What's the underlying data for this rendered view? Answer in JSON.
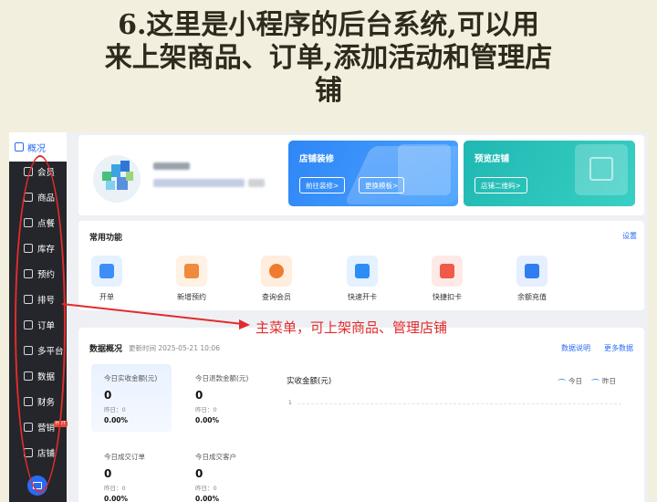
{
  "caption": {
    "line1": "6.这里是小程序的后台系统,可以用",
    "line2": "来上架商品、订单,添加活动和管理店",
    "line3": "铺"
  },
  "sidebar": {
    "active": {
      "label": "概况",
      "icon": "grid-icon"
    },
    "items": [
      {
        "label": "会员",
        "icon": "member-icon"
      },
      {
        "label": "商品",
        "icon": "goods-icon"
      },
      {
        "label": "点餐",
        "icon": "dish-icon"
      },
      {
        "label": "库存",
        "icon": "inventory-icon"
      },
      {
        "label": "预约",
        "icon": "reservation-icon"
      },
      {
        "label": "排号",
        "icon": "queue-icon"
      },
      {
        "label": "订单",
        "icon": "order-icon"
      },
      {
        "label": "多平台",
        "icon": "layers-icon"
      },
      {
        "label": "数据",
        "icon": "data-icon"
      },
      {
        "label": "财务",
        "icon": "finance-icon"
      },
      {
        "label": "营销",
        "icon": "marketing-icon",
        "badge": "HOT"
      },
      {
        "label": "店铺",
        "icon": "store-icon"
      }
    ]
  },
  "promos": [
    {
      "title": "店铺装修",
      "buttons": [
        "前往装修>",
        "更换模板>"
      ]
    },
    {
      "title": "预览店铺",
      "buttons": [
        "店铺二维码>"
      ]
    }
  ],
  "common": {
    "title": "常用功能",
    "settings": "设置",
    "functions": [
      {
        "label": "开单",
        "color": "#3d8ef7",
        "bg": "#e6f1ff"
      },
      {
        "label": "新增预约",
        "color": "#f08a3c",
        "bg": "#fff1e4"
      },
      {
        "label": "查询会员",
        "color": "#f07b2f",
        "bg": "#ffeede"
      },
      {
        "label": "快速开卡",
        "color": "#2c8ef5",
        "bg": "#e4f1ff"
      },
      {
        "label": "快捷扣卡",
        "color": "#ef5a4a",
        "bg": "#ffe9e6"
      },
      {
        "label": "余额充值",
        "color": "#2f7df0",
        "bg": "#e5efff"
      }
    ]
  },
  "overview": {
    "title": "数据概况",
    "updated": "更新时间 2025-05-21 10:06",
    "link_explain": "数据说明",
    "link_more": "更多数据",
    "stats": [
      {
        "title": "今日实收金额(元)",
        "value": "0",
        "yesterday": "昨日：0",
        "pct": "0.00%"
      },
      {
        "title": "今日退款金额(元)",
        "value": "0",
        "yesterday": "昨日：0",
        "pct": "0.00%"
      },
      {
        "title": "今日成交订单",
        "value": "0",
        "yesterday": "昨日：0",
        "pct": "0.00%"
      },
      {
        "title": "今日成交客户",
        "value": "0",
        "yesterday": "昨日：0",
        "pct": "0.00%"
      }
    ],
    "chart_title": "实收金额(元)",
    "chart_tick": "1",
    "legend_today": "今日",
    "legend_yesterday": "昨日"
  },
  "annotation": {
    "text": "主菜单，可上架商品、管理店铺",
    "color": "#e32b2b"
  }
}
